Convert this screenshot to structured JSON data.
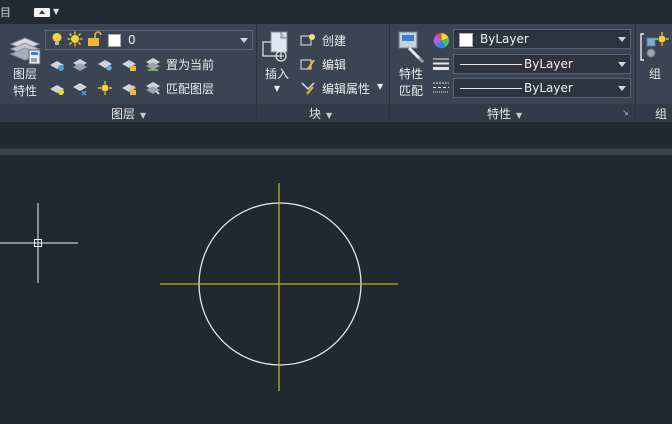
{
  "quick_access": {
    "edge_glyph": "目"
  },
  "layers_panel": {
    "title": "图层",
    "layer_properties_label": "图层\n特性",
    "current_layer": "0",
    "make_current_label": "置为当前",
    "match_layer_label": "匹配图层"
  },
  "block_panel": {
    "title": "块",
    "insert_label": "插入",
    "create_label": "创建",
    "edit_label": "编辑",
    "edit_attributes_label": "编辑属性"
  },
  "properties_panel": {
    "title": "特性",
    "match_properties_label": "特性\n匹配",
    "color_value": "ByLayer",
    "linetype_value": "ByLayer",
    "lineweight_value": "ByLayer"
  },
  "groups_panel": {
    "title": "组",
    "group_label": "组"
  },
  "colors": {
    "ribbon_bg": "#3b4453",
    "canvas_bg": "#212830",
    "circle": "#e8e8e8",
    "centerline": "#b6b21f",
    "crosshair": "#f0f0f0"
  }
}
